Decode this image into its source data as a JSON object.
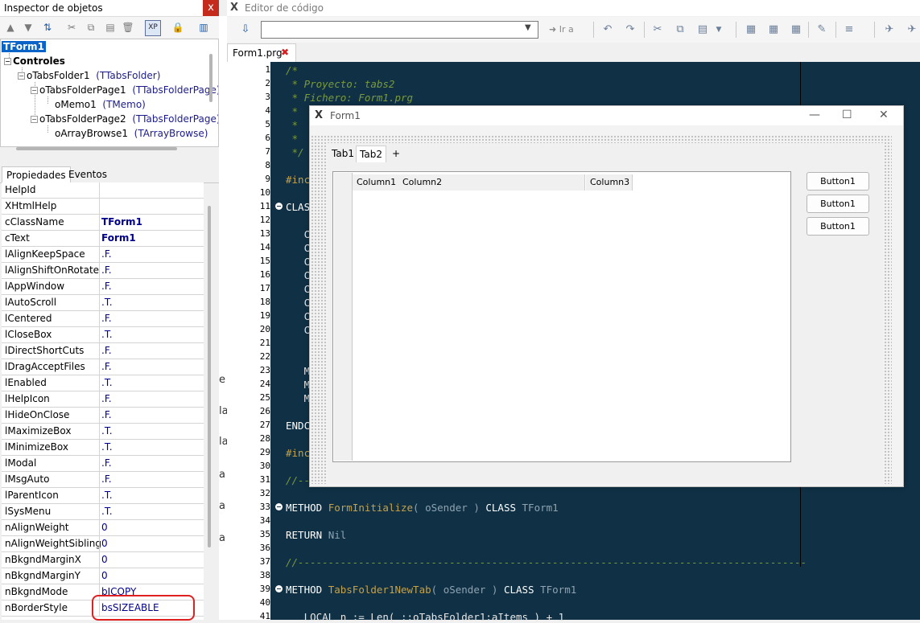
{
  "inspector": {
    "title": "Inspector de objetos",
    "close": "x",
    "tree": {
      "root": "TForm1",
      "group": "Controles",
      "nodes": [
        {
          "name": "oTabsFolder1",
          "class": "(TTabsFolder)"
        },
        {
          "name": "oTabsFolderPage1",
          "class": "(TTabsFolderPage)"
        },
        {
          "name": "oMemo1",
          "class": "(TMemo)"
        },
        {
          "name": "oTabsFolderPage2",
          "class": "(TTabsFolderPage)"
        },
        {
          "name": "oArrayBrowse1",
          "class": "(TArrayBrowse)"
        }
      ]
    },
    "tabs": {
      "properties": "Propiedades",
      "events": "Eventos"
    },
    "properties": [
      {
        "name": "HelpId",
        "value": ""
      },
      {
        "name": "XHtmlHelp",
        "value": ""
      },
      {
        "name": "cClassName",
        "value": "TForm1"
      },
      {
        "name": "cText",
        "value": "Form1"
      },
      {
        "name": "lAlignKeepSpace",
        "value": ".F."
      },
      {
        "name": "lAlignShiftOnRotate",
        "value": ".F."
      },
      {
        "name": "lAppWindow",
        "value": ".F."
      },
      {
        "name": "lAutoScroll",
        "value": ".T."
      },
      {
        "name": "lCentered",
        "value": ".F."
      },
      {
        "name": "lCloseBox",
        "value": ".T."
      },
      {
        "name": "lDirectShortCuts",
        "value": ".F."
      },
      {
        "name": "lDragAcceptFiles",
        "value": ".F."
      },
      {
        "name": "lEnabled",
        "value": ".T."
      },
      {
        "name": "lHelpIcon",
        "value": ".F."
      },
      {
        "name": "lHideOnClose",
        "value": ".F."
      },
      {
        "name": "lMaximizeBox",
        "value": ".T."
      },
      {
        "name": "lMinimizeBox",
        "value": ".T."
      },
      {
        "name": "lModal",
        "value": ".F."
      },
      {
        "name": "lMsgAuto",
        "value": ".F."
      },
      {
        "name": "lParentIcon",
        "value": ".T."
      },
      {
        "name": "lSysMenu",
        "value": ".T."
      },
      {
        "name": "nAlignWeight",
        "value": "0"
      },
      {
        "name": "nAlignWeightSibling",
        "value": "0"
      },
      {
        "name": "nBkgndMarginX",
        "value": "0"
      },
      {
        "name": "nBkgndMarginY",
        "value": "0"
      },
      {
        "name": "nBkgndMode",
        "value": "bICOPY"
      },
      {
        "name": "nBorderStyle",
        "value": "bsSIZEABLE"
      }
    ]
  },
  "editor": {
    "logo": "X",
    "title": "Editor de código",
    "goto_label": "Ir a",
    "file_tab": "Form1.prg",
    "file_tab_close": "✖",
    "line_numbers": [
      "1",
      "2",
      "3",
      "4",
      "5",
      "6",
      "7",
      "8",
      "9",
      "10",
      "11",
      "12",
      "13",
      "14",
      "15",
      "16",
      "17",
      "18",
      "19",
      "20",
      "21",
      "22",
      "23",
      "24",
      "25",
      "26",
      "27",
      "28",
      "29",
      "30",
      "31",
      "32",
      "33",
      "34",
      "35",
      "36",
      "37",
      "38",
      "39",
      "40",
      "41"
    ],
    "code": {
      "l1": "/*",
      "l2": " * Proyecto: tabs2",
      "l3": " * Fichero: Form1.prg",
      "l4": " * ",
      "l5": " * ",
      "l6": " * ",
      "l7": " */",
      "l9": "#inc",
      "l11": "CLAS",
      "l13": "   C",
      "l14": "   C",
      "l15": "   C",
      "l16": "   C",
      "l17": "   C",
      "l18": "   C",
      "l19": "   C",
      "l20": "   C",
      "l23": "   M",
      "l24": "   M",
      "l25": "   M",
      "l27": "ENDC",
      "l29": "#inc",
      "l31": "//--",
      "l33_kw": "METHOD ",
      "l33_fn": "FormInitialize",
      "l33_rest1": "( ",
      "l33_id": "oSender",
      "l33_rest2": " ) ",
      "l33_kw2": "CLASS ",
      "l33_id2": "TForm1",
      "l35_kw": "RETURN ",
      "l35_id": "Nil",
      "l37": "//------------------------------------------------------------------------------------",
      "l39_kw": "METHOD ",
      "l39_fn": "TabsFolder1NewTab",
      "l39_rest1": "( ",
      "l39_id": "oSender",
      "l39_rest2": " ) ",
      "l39_kw2": "CLASS ",
      "l39_id2": "TForm1",
      "l41": "   LOCAL n := Len( ::oTabsFolder1:aItems ) + 1"
    }
  },
  "form": {
    "logo": "X",
    "title": "Form1",
    "tabs": [
      "Tab1",
      "Tab2",
      "+"
    ],
    "columns": [
      "Column1",
      "Column2",
      "Column3"
    ],
    "buttons": [
      "Button1",
      "Button1",
      "Button1"
    ]
  },
  "hidden_strip": [
    "e",
    "la",
    "la",
    "a",
    "a",
    "a"
  ]
}
